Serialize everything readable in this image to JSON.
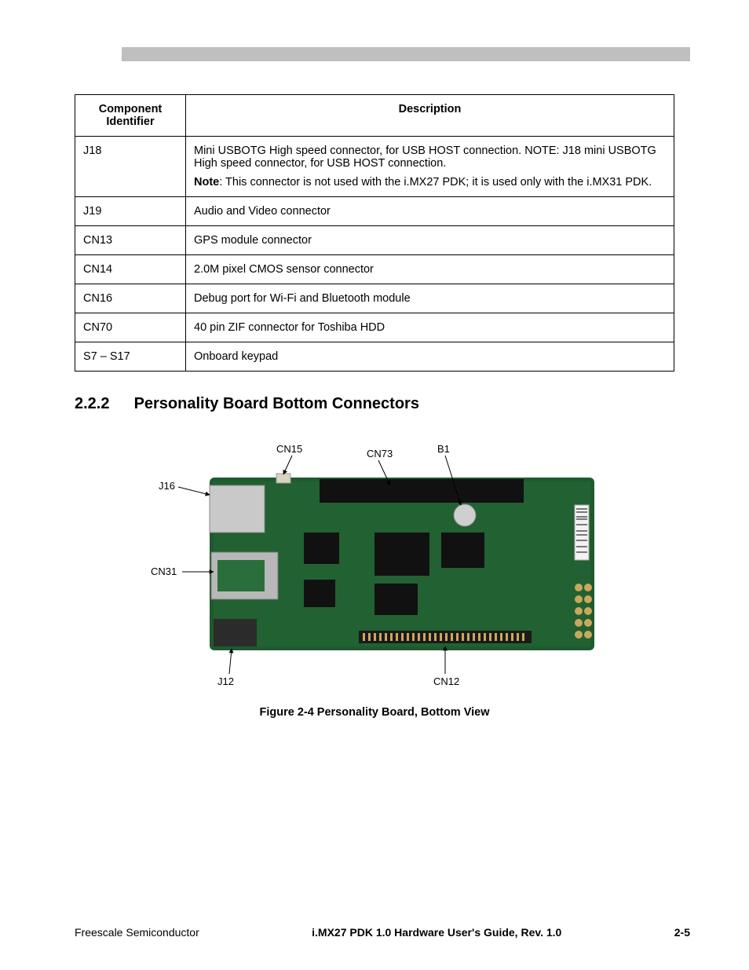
{
  "table": {
    "headers": {
      "id": "Component Identifier",
      "desc": "Description"
    },
    "rows": [
      {
        "id": "J18",
        "desc_p1": "Mini USBOTG High speed connector, for USB HOST connection. NOTE: J18 mini USBOTG High speed connector, for USB HOST connection.",
        "note_label": "Note",
        "note_text": ": This connector is not used with the i.MX27 PDK; it is used only with the i.MX31 PDK."
      },
      {
        "id": "J19",
        "desc": "Audio and Video connector"
      },
      {
        "id": "CN13",
        "desc": "GPS module connector"
      },
      {
        "id": "CN14",
        "desc": "2.0M pixel CMOS sensor connector"
      },
      {
        "id": "CN16",
        "desc": "Debug port for Wi-Fi and Bluetooth module"
      },
      {
        "id": "CN70",
        "desc": "40 pin ZIF connector for Toshiba HDD"
      },
      {
        "id": "S7 – S17",
        "desc": "Onboard keypad"
      }
    ]
  },
  "section": {
    "number": "2.2.2",
    "title": "Personality Board Bottom Connectors"
  },
  "figure": {
    "caption": "Figure 2-4 Personality Board, Bottom View",
    "callouts": [
      "CN15",
      "CN73",
      "B1",
      "J16",
      "CN31",
      "J12",
      "CN12"
    ]
  },
  "footer": {
    "left": "Freescale Semiconductor",
    "center": "i.MX27 PDK 1.0 Hardware User's Guide, Rev. 1.0",
    "right": "2-5"
  }
}
